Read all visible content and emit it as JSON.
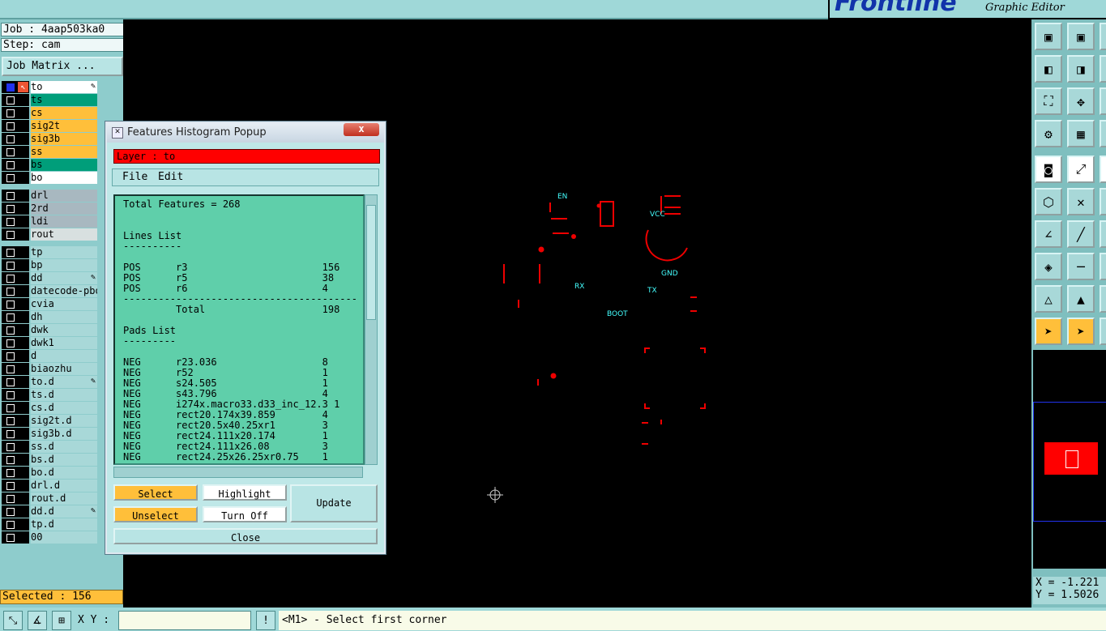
{
  "brand": {
    "logo": "Frontline",
    "subtitle": "Graphic Editor"
  },
  "info": {
    "job": "Job : 4aap503ka0",
    "step": "Step: cam",
    "job_matrix_label": "Job Matrix ...",
    "selected": "Selected : 156"
  },
  "layers": [
    {
      "name": "to",
      "color": "#ffffff",
      "edit": true
    },
    {
      "name": "ts",
      "color": "#009e7a"
    },
    {
      "name": "cs",
      "color": "#ffbf3a"
    },
    {
      "name": "sig2t",
      "color": "#ffbf3a"
    },
    {
      "name": "sig3b",
      "color": "#ffbf3a"
    },
    {
      "name": "ss",
      "color": "#ffbf3a"
    },
    {
      "name": "bs",
      "color": "#009e7a"
    },
    {
      "name": "bo",
      "color": "#ffffff"
    },
    {
      "name": "drl",
      "color": "#a8b8c0"
    },
    {
      "name": "2rd",
      "color": "#a8b8c0"
    },
    {
      "name": "ldi",
      "color": "#a8b8c0"
    },
    {
      "name": "rout",
      "color": "#d8e0e0"
    },
    {
      "name": "tp",
      "color": "#a8d8d8"
    },
    {
      "name": "bp",
      "color": "#a8d8d8"
    },
    {
      "name": "dd",
      "color": "#a8d8d8",
      "edit": true
    },
    {
      "name": "datecode-pbo",
      "color": "#a8d8d8"
    },
    {
      "name": "cvia",
      "color": "#a8d8d8"
    },
    {
      "name": "dh",
      "color": "#a8d8d8"
    },
    {
      "name": "dwk",
      "color": "#a8d8d8"
    },
    {
      "name": "dwk1",
      "color": "#a8d8d8"
    },
    {
      "name": "d",
      "color": "#a8d8d8"
    },
    {
      "name": "biaozhu",
      "color": "#a8d8d8"
    },
    {
      "name": "to.d",
      "color": "#a8d8d8",
      "edit": true
    },
    {
      "name": "ts.d",
      "color": "#a8d8d8"
    },
    {
      "name": "cs.d",
      "color": "#a8d8d8"
    },
    {
      "name": "sig2t.d",
      "color": "#a8d8d8"
    },
    {
      "name": "sig3b.d",
      "color": "#a8d8d8"
    },
    {
      "name": "ss.d",
      "color": "#a8d8d8"
    },
    {
      "name": "bs.d",
      "color": "#a8d8d8"
    },
    {
      "name": "bo.d",
      "color": "#a8d8d8"
    },
    {
      "name": "drl.d",
      "color": "#a8d8d8"
    },
    {
      "name": "rout.d",
      "color": "#a8d8d8"
    },
    {
      "name": "dd.d",
      "color": "#a8d8d8",
      "edit": true
    },
    {
      "name": "tp.d",
      "color": "#a8d8d8"
    },
    {
      "name": "00",
      "color": "#a8d8d8"
    }
  ],
  "canvas_labels": {
    "en": "EN",
    "vcc": "VCC",
    "gnd": "GND",
    "rx": "RX",
    "tx": "TX",
    "boot": "BOOT"
  },
  "coords": {
    "x": "X = -1.221",
    "y": "Y = 1.5026"
  },
  "bottom": {
    "xy_label": "X Y :",
    "status": "<M1> - Select first corner",
    "warn": "!"
  },
  "popup": {
    "title": "Features Histogram Popup",
    "close_x": "x",
    "layer": "Layer :  to",
    "menu_file": "File",
    "menu_edit": "Edit",
    "lines": [
      "Total Features = 268",
      "",
      "",
      "Lines List",
      "----------",
      "",
      "POS      r3                       156",
      "POS      r5                       38",
      "POS      r6                       4",
      "----------------------------------------",
      "         Total                    198",
      "",
      "Pads List",
      "---------",
      "",
      "NEG      r23.036                  8",
      "NEG      r52                      1",
      "NEG      s24.505                  1",
      "NEG      s43.796                  4",
      "NEG      i274x.macro33.d33_inc_12.3 1",
      "NEG      rect20.174x39.859        4",
      "NEG      rect20.5x40.25xr1        3",
      "NEG      rect24.111x20.174        1",
      "NEG      rect24.111x26.08         3",
      "NEG      rect24.25x26.25xr0.75    1"
    ],
    "btn_select": "Select",
    "btn_unselect": "Unselect",
    "btn_highlight": "Highlight",
    "btn_turnoff": "Turn Off",
    "btn_update": "Update",
    "btn_close": "Close"
  }
}
